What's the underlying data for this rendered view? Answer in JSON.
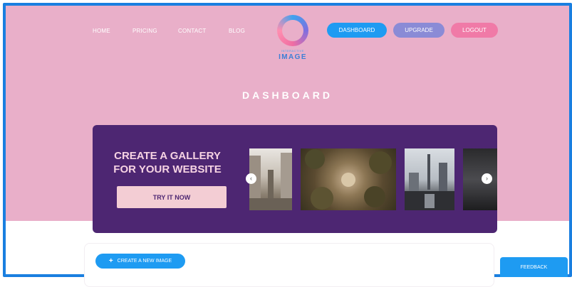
{
  "nav": {
    "links": [
      "HOME",
      "PRICING",
      "CONTACT",
      "BLOG"
    ],
    "logo": {
      "subtitle": "INTERACTIVE",
      "text": "IMAGE"
    },
    "buttons": {
      "dashboard": "DASHBOARD",
      "upgrade": "UPGRADE",
      "logout": "LOGOUT"
    }
  },
  "page_title": "DASHBOARD",
  "gallery_banner": {
    "title_line1": "CREATE A GALLERY",
    "title_line2": "FOR YOUR WEBSITE",
    "cta": "TRY IT NOW",
    "arrows": {
      "prev": "‹",
      "next": "›"
    }
  },
  "actions": {
    "create_image": "CREATE A NEW IMAGE",
    "create_icon": "+"
  },
  "feedback": "FEEDBACK",
  "colors": {
    "hero_bg": "#e9afc9",
    "banner_bg": "#4d2672",
    "accent_blue": "#1e9bf2",
    "upgrade": "#8a8bd6",
    "logout": "#f07aa7"
  }
}
